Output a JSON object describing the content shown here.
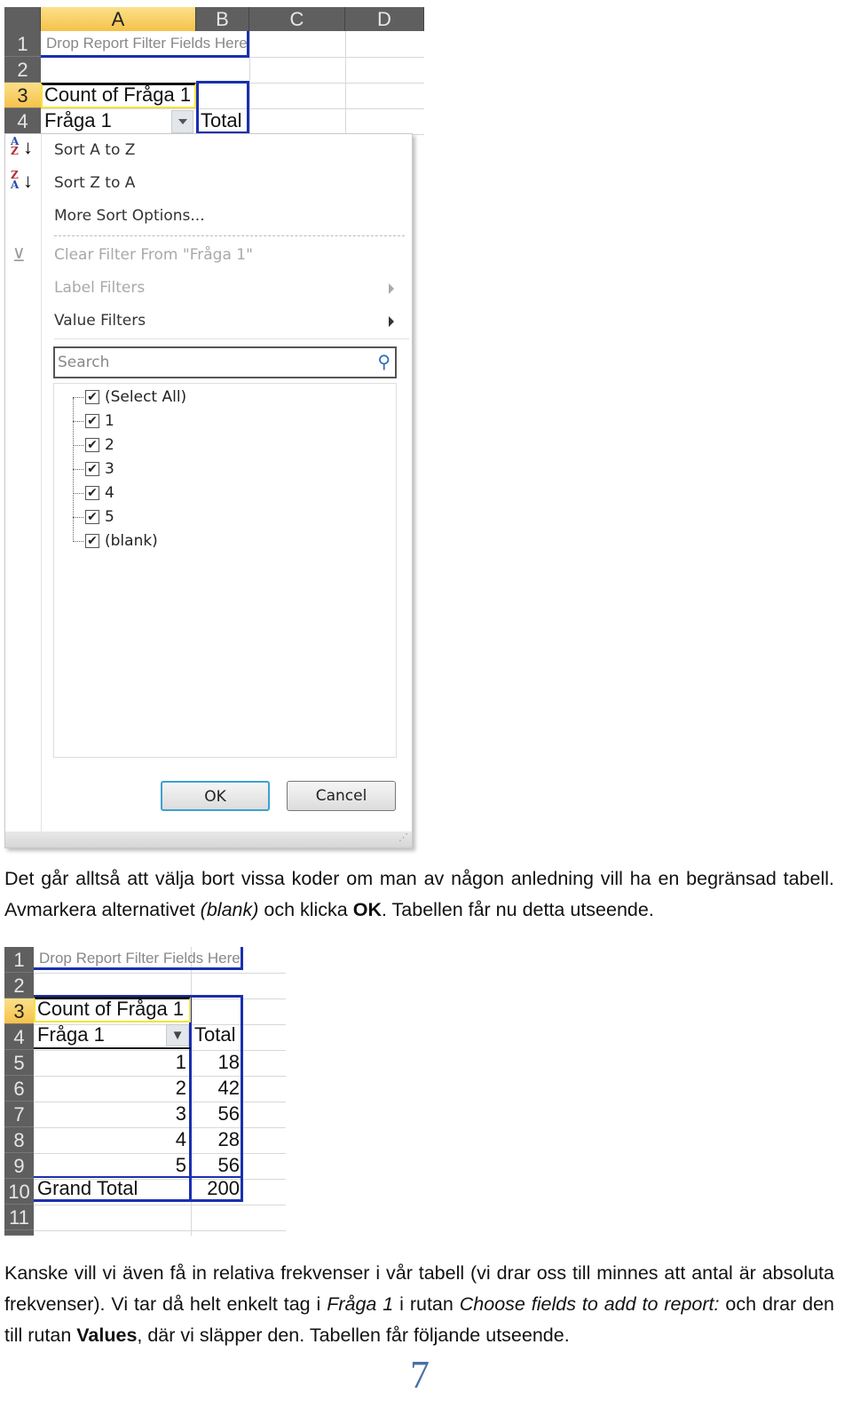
{
  "screenshot1": {
    "columns": [
      "A",
      "B",
      "C",
      "D"
    ],
    "rows": [
      "1",
      "2",
      "3",
      "4"
    ],
    "report_filter_placeholder": "Drop Report Filter Fields Here",
    "values_header": "Count of Fråga 1",
    "row_field": "Fråga 1",
    "column_total": "Total",
    "menu": {
      "items": [
        {
          "label": "Sort A to Z",
          "icon": "sort-a-z-icon",
          "enabled": true
        },
        {
          "label": "Sort Z to A",
          "icon": "sort-z-a-icon",
          "enabled": true
        },
        {
          "label": "More Sort Options...",
          "enabled": true
        },
        {
          "label": "Clear Filter From \"Fråga 1\"",
          "icon": "clear-filter-icon",
          "enabled": false
        },
        {
          "label": "Label Filters",
          "submenu": true,
          "enabled": false
        },
        {
          "label": "Value Filters",
          "submenu": true,
          "enabled": true
        }
      ],
      "search_placeholder": "Search",
      "list": [
        {
          "label": "(Select All)",
          "checked": true
        },
        {
          "label": "1",
          "checked": true
        },
        {
          "label": "2",
          "checked": true
        },
        {
          "label": "3",
          "checked": true
        },
        {
          "label": "4",
          "checked": true
        },
        {
          "label": "5",
          "checked": true
        },
        {
          "label": "(blank)",
          "checked": true
        }
      ],
      "ok_label": "OK",
      "cancel_label": "Cancel"
    }
  },
  "paragraph1": {
    "t1": "Det går alltså att välja bort vissa koder om man av någon anledning vill ha en begränsad tabell. Avmarkera alternativet ",
    "em1": "(blank)",
    "t2": " och klicka ",
    "b1": "OK",
    "t3": ". Tabellen får nu detta utseende."
  },
  "screenshot2": {
    "rows": [
      "1",
      "2",
      "3",
      "4",
      "5",
      "6",
      "7",
      "8",
      "9",
      "10",
      "11"
    ],
    "report_filter_placeholder": "Drop Report Filter Fields Here",
    "values_header": "Count of Fråga 1",
    "row_field": "Fråga 1",
    "column_total": "Total",
    "data": [
      {
        "code": "1",
        "total": "18"
      },
      {
        "code": "2",
        "total": "42"
      },
      {
        "code": "3",
        "total": "56"
      },
      {
        "code": "4",
        "total": "28"
      },
      {
        "code": "5",
        "total": "56"
      }
    ],
    "grand_total_label": "Grand Total",
    "grand_total": "200"
  },
  "paragraph2": {
    "t1": "Kanske vill vi även få in relativa frekvenser i vår tabell (vi drar oss till minnes att antal är absoluta frekvenser). Vi tar då helt enkelt tag i ",
    "em1": "Fråga 1",
    "t2": " i rutan ",
    "em2": "Choose fields to add to report:",
    "t3": " och drar den till rutan ",
    "b1": "Values",
    "t4": ", där vi släpper den. Tabellen får följande utseende."
  },
  "page_number": "7",
  "colors": {
    "pivot_border": "#1a2fb0",
    "header_bg": "#5f5f5f",
    "selected_header": "#f6c24a",
    "page_number": "#4a6fa5"
  }
}
